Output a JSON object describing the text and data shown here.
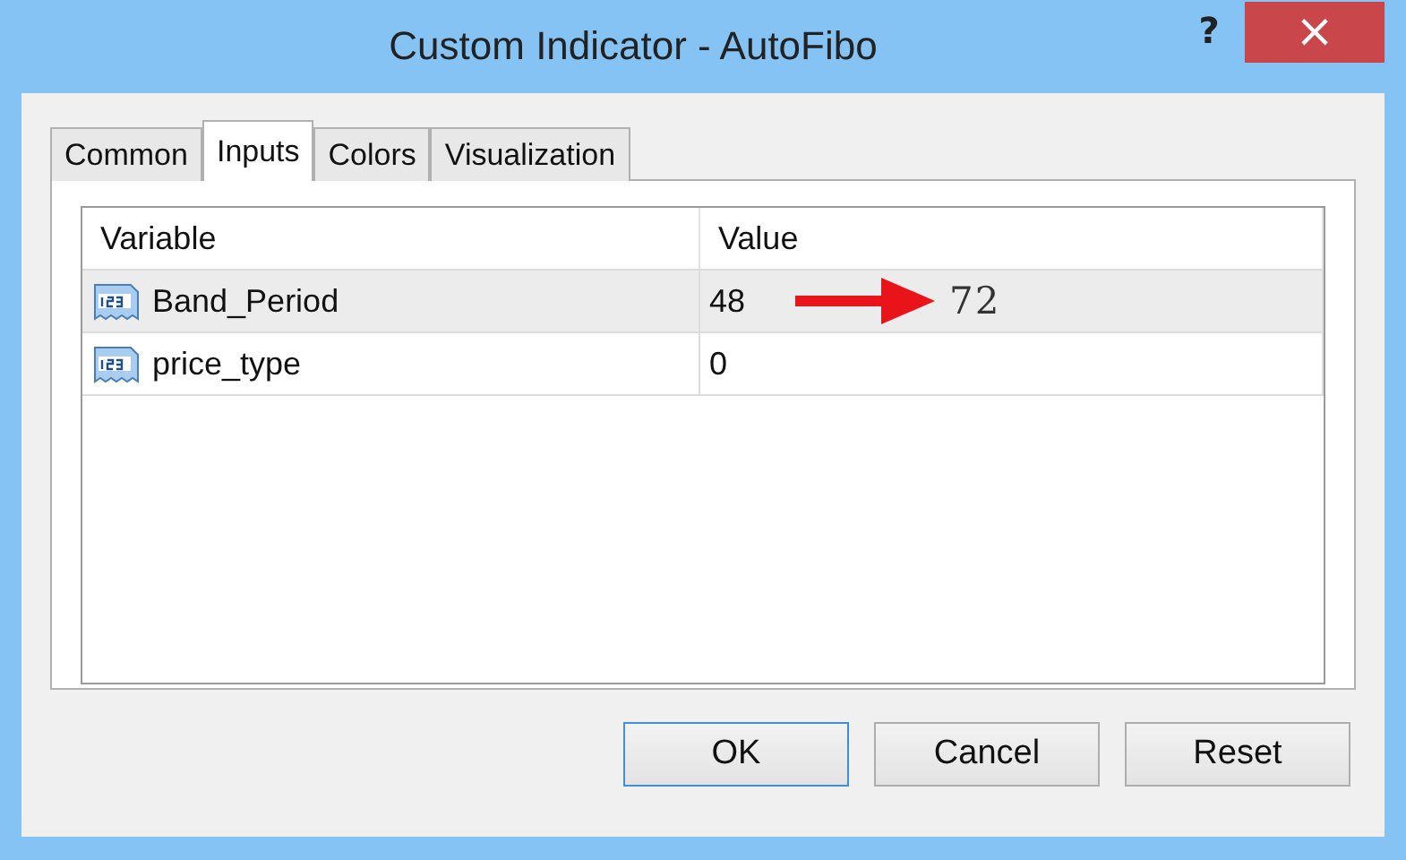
{
  "window": {
    "title": "Custom Indicator - AutoFibo",
    "help": "?",
    "close": "×"
  },
  "tabs": [
    {
      "label": "Common",
      "selected": false
    },
    {
      "label": "Inputs",
      "selected": true
    },
    {
      "label": "Colors",
      "selected": false
    },
    {
      "label": "Visualization",
      "selected": false
    }
  ],
  "table": {
    "columns": [
      "Variable",
      "Value"
    ],
    "rows": [
      {
        "variable": "Band_Period",
        "value": "48",
        "selected": true,
        "annotation": "72"
      },
      {
        "variable": "price_type",
        "value": "0",
        "selected": false
      }
    ]
  },
  "buttons": [
    {
      "label": "OK",
      "default": true
    },
    {
      "label": "Cancel",
      "default": false
    },
    {
      "label": "Reset",
      "default": false
    }
  ]
}
